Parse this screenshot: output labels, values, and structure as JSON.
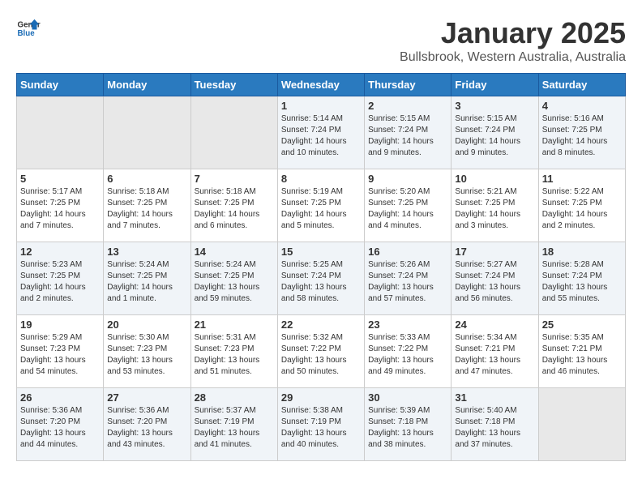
{
  "header": {
    "logo_line1": "General",
    "logo_line2": "Blue",
    "title": "January 2025",
    "subtitle": "Bullsbrook, Western Australia, Australia"
  },
  "weekdays": [
    "Sunday",
    "Monday",
    "Tuesday",
    "Wednesday",
    "Thursday",
    "Friday",
    "Saturday"
  ],
  "weeks": [
    [
      {
        "day": "",
        "sunrise": "",
        "sunset": "",
        "daylight": ""
      },
      {
        "day": "",
        "sunrise": "",
        "sunset": "",
        "daylight": ""
      },
      {
        "day": "",
        "sunrise": "",
        "sunset": "",
        "daylight": ""
      },
      {
        "day": "1",
        "sunrise": "5:14 AM",
        "sunset": "7:24 PM",
        "daylight": "14 hours and 10 minutes."
      },
      {
        "day": "2",
        "sunrise": "5:15 AM",
        "sunset": "7:24 PM",
        "daylight": "14 hours and 9 minutes."
      },
      {
        "day": "3",
        "sunrise": "5:15 AM",
        "sunset": "7:24 PM",
        "daylight": "14 hours and 9 minutes."
      },
      {
        "day": "4",
        "sunrise": "5:16 AM",
        "sunset": "7:25 PM",
        "daylight": "14 hours and 8 minutes."
      }
    ],
    [
      {
        "day": "5",
        "sunrise": "5:17 AM",
        "sunset": "7:25 PM",
        "daylight": "14 hours and 7 minutes."
      },
      {
        "day": "6",
        "sunrise": "5:18 AM",
        "sunset": "7:25 PM",
        "daylight": "14 hours and 7 minutes."
      },
      {
        "day": "7",
        "sunrise": "5:18 AM",
        "sunset": "7:25 PM",
        "daylight": "14 hours and 6 minutes."
      },
      {
        "day": "8",
        "sunrise": "5:19 AM",
        "sunset": "7:25 PM",
        "daylight": "14 hours and 5 minutes."
      },
      {
        "day": "9",
        "sunrise": "5:20 AM",
        "sunset": "7:25 PM",
        "daylight": "14 hours and 4 minutes."
      },
      {
        "day": "10",
        "sunrise": "5:21 AM",
        "sunset": "7:25 PM",
        "daylight": "14 hours and 3 minutes."
      },
      {
        "day": "11",
        "sunrise": "5:22 AM",
        "sunset": "7:25 PM",
        "daylight": "14 hours and 2 minutes."
      }
    ],
    [
      {
        "day": "12",
        "sunrise": "5:23 AM",
        "sunset": "7:25 PM",
        "daylight": "14 hours and 2 minutes."
      },
      {
        "day": "13",
        "sunrise": "5:24 AM",
        "sunset": "7:25 PM",
        "daylight": "14 hours and 1 minute."
      },
      {
        "day": "14",
        "sunrise": "5:24 AM",
        "sunset": "7:25 PM",
        "daylight": "13 hours and 59 minutes."
      },
      {
        "day": "15",
        "sunrise": "5:25 AM",
        "sunset": "7:24 PM",
        "daylight": "13 hours and 58 minutes."
      },
      {
        "day": "16",
        "sunrise": "5:26 AM",
        "sunset": "7:24 PM",
        "daylight": "13 hours and 57 minutes."
      },
      {
        "day": "17",
        "sunrise": "5:27 AM",
        "sunset": "7:24 PM",
        "daylight": "13 hours and 56 minutes."
      },
      {
        "day": "18",
        "sunrise": "5:28 AM",
        "sunset": "7:24 PM",
        "daylight": "13 hours and 55 minutes."
      }
    ],
    [
      {
        "day": "19",
        "sunrise": "5:29 AM",
        "sunset": "7:23 PM",
        "daylight": "13 hours and 54 minutes."
      },
      {
        "day": "20",
        "sunrise": "5:30 AM",
        "sunset": "7:23 PM",
        "daylight": "13 hours and 53 minutes."
      },
      {
        "day": "21",
        "sunrise": "5:31 AM",
        "sunset": "7:23 PM",
        "daylight": "13 hours and 51 minutes."
      },
      {
        "day": "22",
        "sunrise": "5:32 AM",
        "sunset": "7:22 PM",
        "daylight": "13 hours and 50 minutes."
      },
      {
        "day": "23",
        "sunrise": "5:33 AM",
        "sunset": "7:22 PM",
        "daylight": "13 hours and 49 minutes."
      },
      {
        "day": "24",
        "sunrise": "5:34 AM",
        "sunset": "7:21 PM",
        "daylight": "13 hours and 47 minutes."
      },
      {
        "day": "25",
        "sunrise": "5:35 AM",
        "sunset": "7:21 PM",
        "daylight": "13 hours and 46 minutes."
      }
    ],
    [
      {
        "day": "26",
        "sunrise": "5:36 AM",
        "sunset": "7:20 PM",
        "daylight": "13 hours and 44 minutes."
      },
      {
        "day": "27",
        "sunrise": "5:36 AM",
        "sunset": "7:20 PM",
        "daylight": "13 hours and 43 minutes."
      },
      {
        "day": "28",
        "sunrise": "5:37 AM",
        "sunset": "7:19 PM",
        "daylight": "13 hours and 41 minutes."
      },
      {
        "day": "29",
        "sunrise": "5:38 AM",
        "sunset": "7:19 PM",
        "daylight": "13 hours and 40 minutes."
      },
      {
        "day": "30",
        "sunrise": "5:39 AM",
        "sunset": "7:18 PM",
        "daylight": "13 hours and 38 minutes."
      },
      {
        "day": "31",
        "sunrise": "5:40 AM",
        "sunset": "7:18 PM",
        "daylight": "13 hours and 37 minutes."
      },
      {
        "day": "",
        "sunrise": "",
        "sunset": "",
        "daylight": ""
      }
    ]
  ]
}
